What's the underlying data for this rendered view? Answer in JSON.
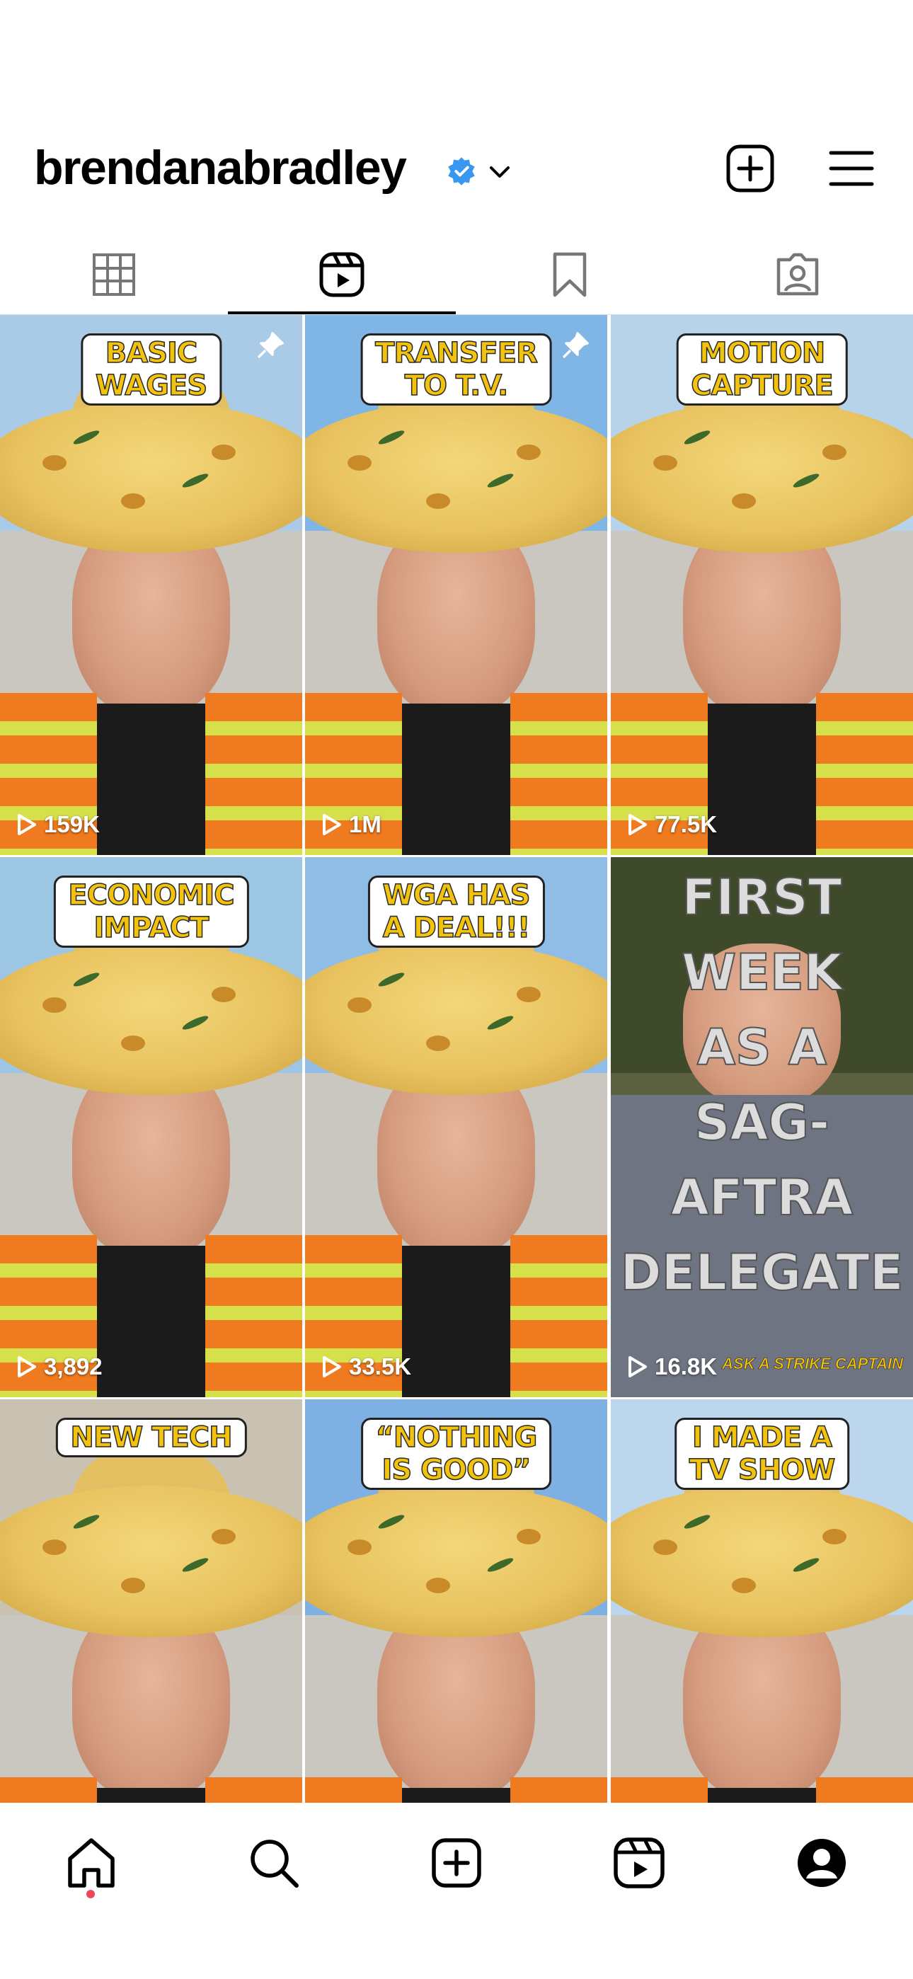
{
  "profile": {
    "username": "brendanabradley",
    "verified": true,
    "verified_color": "#3897f0"
  },
  "header_actions": [
    {
      "name": "create-icon"
    },
    {
      "name": "menu-icon"
    }
  ],
  "tabs": [
    {
      "name": "grid-icon",
      "active": false
    },
    {
      "name": "reels-icon",
      "active": true
    },
    {
      "name": "saved-icon",
      "active": false
    },
    {
      "name": "tagged-icon",
      "active": false
    }
  ],
  "reels": [
    {
      "caption": "BASIC\nWAGES",
      "views": "159K",
      "pinned": true
    },
    {
      "caption": "TRANSFER\nTO T.V.",
      "views": "1M",
      "pinned": true
    },
    {
      "caption": "MOTION\nCAPTURE",
      "views": "77.5K",
      "pinned": false
    },
    {
      "caption": "ECONOMIC\nIMPACT",
      "views": "3,892",
      "pinned": false
    },
    {
      "caption": "WGA HAS\nA DEAL!!!",
      "views": "33.5K",
      "pinned": false
    },
    {
      "caption": "FIRST\nWEEK\nAS A\nSAG-\nAFTRA\nDELEGATE",
      "views": "16.8K",
      "pinned": false,
      "watermark": "ASK A STRIKE CAPTAIN",
      "style": "big"
    },
    {
      "caption": "NEW TECH",
      "views": "",
      "pinned": false
    },
    {
      "caption": "“NOTHING\nIS GOOD”",
      "views": "",
      "pinned": false
    },
    {
      "caption": "I MADE A\nTV SHOW",
      "views": "",
      "pinned": false
    }
  ],
  "bottom_nav": [
    {
      "name": "home-icon",
      "active": true,
      "notification_dot": true
    },
    {
      "name": "search-icon",
      "active": false
    },
    {
      "name": "new-post-icon",
      "active": false
    },
    {
      "name": "reels-nav-icon",
      "active": false
    },
    {
      "name": "profile-icon",
      "active": false
    }
  ],
  "colors": {
    "caption_text": "#f2c20d",
    "notification_dot": "#ed4956"
  }
}
